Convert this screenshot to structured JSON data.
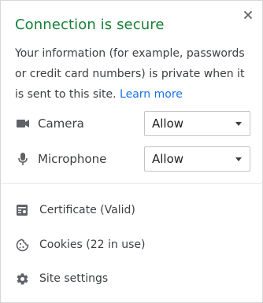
{
  "header": {
    "title": "Connection is secure",
    "title_color": "#188038",
    "close_icon": "close-icon"
  },
  "info": {
    "text": "Your information (for example, passwords or credit card numbers) is private when it is sent to this site.",
    "learn_more": "Learn more",
    "link_color": "#1a73e8"
  },
  "permissions": [
    {
      "label": "Camera",
      "icon": "camera-icon",
      "value": "Allow"
    },
    {
      "label": "Microphone",
      "icon": "microphone-icon",
      "value": "Allow"
    }
  ],
  "links": [
    {
      "label": "Certificate (Valid)",
      "icon": "certificate-icon"
    },
    {
      "label": "Cookies (22 in use)",
      "icon": "cookie-icon"
    },
    {
      "label": "Site settings",
      "icon": "gear-icon"
    }
  ]
}
